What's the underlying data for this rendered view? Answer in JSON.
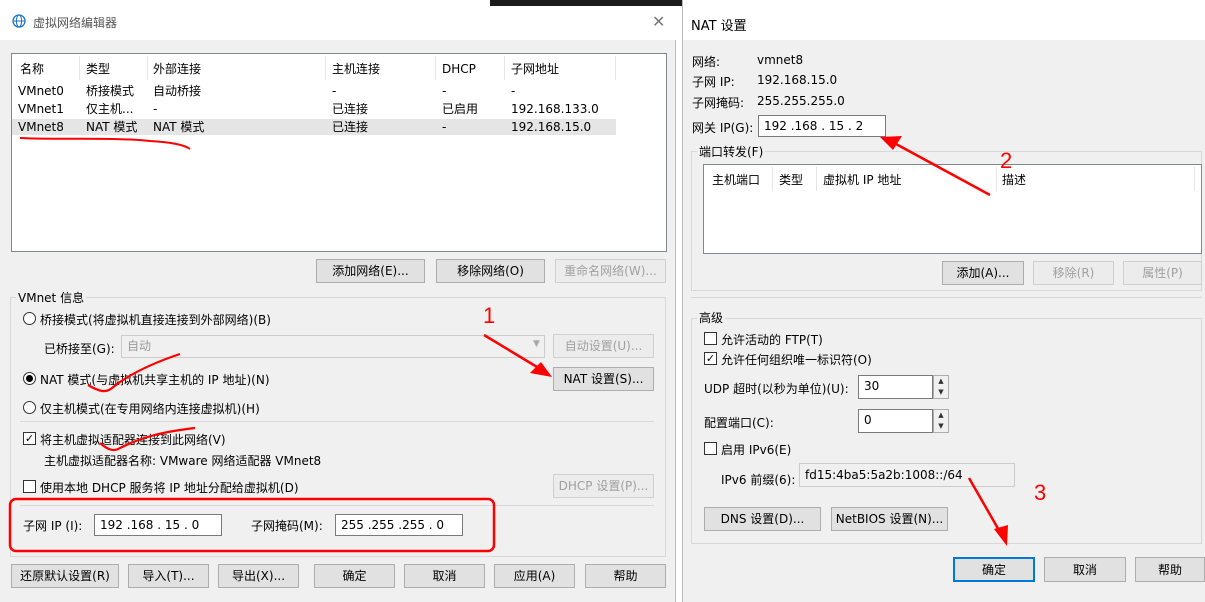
{
  "left": {
    "title": "虚拟网络编辑器",
    "columns": [
      "名称",
      "类型",
      "外部连接",
      "主机连接",
      "DHCP",
      "子网地址"
    ],
    "rows": [
      [
        "VMnet0",
        "桥接模式",
        "自动桥接",
        "-",
        "-",
        "-"
      ],
      [
        "VMnet1",
        "仅主机...",
        "-",
        "已连接",
        "已启用",
        "192.168.133.0"
      ],
      [
        "VMnet8",
        "NAT 模式",
        "NAT 模式",
        "已连接",
        "-",
        "192.168.15.0"
      ]
    ],
    "btn_add_net": "添加网络(E)...",
    "btn_remove_net": "移除网络(O)",
    "btn_rename_net": "重命名网络(W)...",
    "vmnet_group": "VMnet 信息",
    "radio_bridge": "桥接模式(将虚拟机直接连接到外部网络)(B)",
    "bridged_to_label": "已桥接至(G):",
    "bridged_to_value": "自动",
    "btn_auto_setting": "自动设置(U)...",
    "radio_nat": "NAT 模式(与虚拟机共享主机的 IP 地址)(N)",
    "btn_nat_setting": "NAT 设置(S)...",
    "radio_hostonly": "仅主机模式(在专用网络内连接虚拟机)(H)",
    "check_connect_adapter": "将主机虚拟适配器连接到此网络(V)",
    "adapter_name": "主机虚拟适配器名称: VMware 网络适配器 VMnet8",
    "check_dhcp": "使用本地 DHCP 服务将 IP 地址分配给虚拟机(D)",
    "btn_dhcp_setting": "DHCP 设置(P)...",
    "subnet_ip_label": "子网 IP (I):",
    "subnet_ip_value": "192 .168 . 15 . 0",
    "subnet_mask_label": "子网掩码(M):",
    "subnet_mask_value": "255 .255 .255 . 0",
    "btn_restore": "还原默认设置(R)",
    "btn_import": "导入(T)...",
    "btn_export": "导出(X)...",
    "btn_ok": "确定",
    "btn_cancel": "取消",
    "btn_apply": "应用(A)",
    "btn_help": "帮助"
  },
  "right": {
    "title": "NAT 设置",
    "network_label": "网络:",
    "network_value": "vmnet8",
    "subnet_ip_label": "子网 IP:",
    "subnet_ip_value": "192.168.15.0",
    "subnet_mask_label": "子网掩码:",
    "subnet_mask_value": "255.255.255.0",
    "gateway_label": "网关 IP(G):",
    "gateway_value": "192 .168 . 15 . 2",
    "port_forward_group": "端口转发(F)",
    "pf_columns": [
      "主机端口",
      "类型",
      "虚拟机 IP 地址",
      "描述"
    ],
    "btn_add": "添加(A)...",
    "btn_remove": "移除(R)",
    "btn_props": "属性(P)",
    "advanced_group": "高级",
    "check_ftp": "允许活动的 FTP(T)",
    "check_uid": "允许任何组织唯一标识符(O)",
    "udp_label": "UDP 超时(以秒为单位)(U):",
    "udp_value": "30",
    "config_port_label": "配置端口(C):",
    "config_port_value": "0",
    "check_ipv6": "启用 IPv6(E)",
    "ipv6_prefix_label": "IPv6 前缀(6):",
    "ipv6_prefix_value": "fd15:4ba5:5a2b:1008::/64",
    "btn_dns": "DNS 设置(D)...",
    "btn_netbios": "NetBIOS 设置(N)...",
    "btn_ok": "确定",
    "btn_cancel": "取消",
    "btn_help": "帮助"
  },
  "annotations": {
    "num1": "1",
    "num2": "2",
    "num3": "3"
  },
  "colors": {
    "annotation": "#ff0000",
    "accent": "#0078d7",
    "selection": "#e5e5e5"
  }
}
